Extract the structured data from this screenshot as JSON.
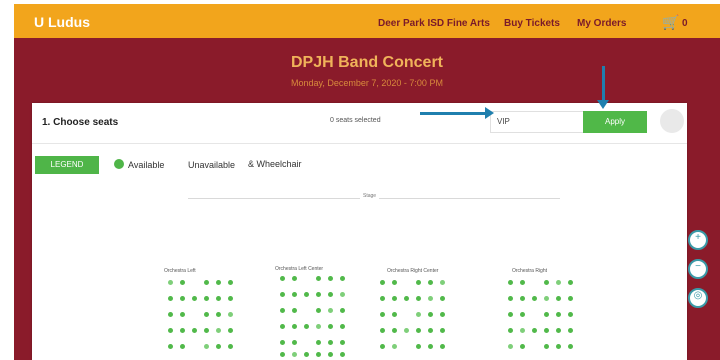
{
  "header": {
    "brand": "U Ludus",
    "nav": [
      "Deer Park ISD Fine Arts",
      "Buy Tickets",
      "My Orders"
    ],
    "cart_count": "0",
    "colors": {
      "header_bg": "#f2a51c",
      "banner_bg": "#8a1b2a"
    }
  },
  "event": {
    "title": "DPJH Band Concert",
    "date": "Monday, December 7, 2020 - 7:00 PM"
  },
  "panel": {
    "step_title": "1. Choose seats",
    "selected": "0 seats selected",
    "promo_value": "VIP",
    "apply_label": "Apply"
  },
  "legend": {
    "button": "LEGEND",
    "items": [
      "Available",
      "Unavailable",
      "& Wheelchair"
    ]
  },
  "seating": {
    "stage_label": "Stage",
    "sections": [
      "Orchestra Left",
      "Orchestra Left Center",
      "Orchestra Right Center",
      "Orchestra Right"
    ]
  },
  "icons": [
    "cart-icon",
    "zoom-in-icon",
    "zoom-out-icon",
    "zoom-reset-icon"
  ]
}
